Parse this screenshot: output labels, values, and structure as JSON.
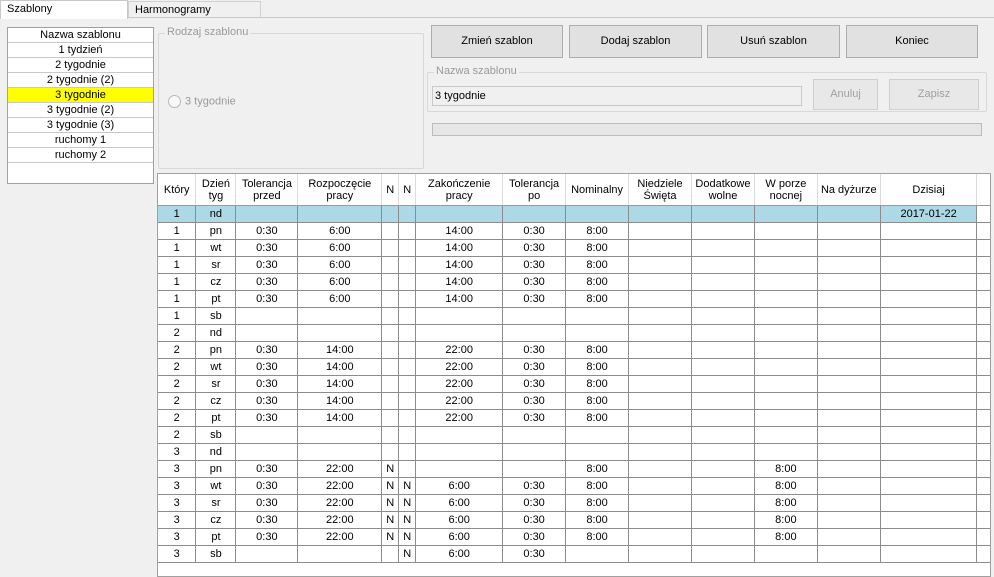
{
  "tabs": [
    "Szablony",
    "Harmonogramy"
  ],
  "templates": {
    "header": "Nazwa szablonu",
    "items": [
      "1 tydzień",
      "2 tygodnie",
      "2 tygodnie (2)",
      "3 tygodnie",
      "3 tygodnie (2)",
      "3 tygodnie (3)",
      "ruchomy 1",
      "ruchomy 2"
    ],
    "selected": "3 tygodnie"
  },
  "rodzaj": {
    "legend": "Rodzaj szablonu",
    "option": "3 tygodnie"
  },
  "buttons": {
    "zmien": "Zmień szablon",
    "dodaj": "Dodaj szablon",
    "usun": "Usuń szablon",
    "koniec": "Koniec",
    "anuluj": "Anuluj",
    "zapisz": "Zapisz"
  },
  "nazwa": {
    "legend": "Nazwa szablonu",
    "value": "3 tygodnie"
  },
  "grid": {
    "columns": [
      "Który",
      "Dzień tyg",
      "Tolerancja przed",
      "Rozpoczęcie pracy",
      "N",
      "N",
      "Zakończenie pracy",
      "Tolerancja po",
      "Nominalny",
      "Niedziele Święta",
      "Dodatkowe wolne",
      "W porze nocnej",
      "Na dyżurze",
      "Dzisiaj"
    ],
    "rows": [
      [
        "1",
        "nd",
        "",
        "",
        "",
        "",
        "",
        "",
        "",
        "",
        "",
        "",
        "",
        "2017-01-22"
      ],
      [
        "1",
        "pn",
        "0:30",
        "6:00",
        "",
        "",
        "14:00",
        "0:30",
        "8:00",
        "",
        "",
        "",
        "",
        ""
      ],
      [
        "1",
        "wt",
        "0:30",
        "6:00",
        "",
        "",
        "14:00",
        "0:30",
        "8:00",
        "",
        "",
        "",
        "",
        ""
      ],
      [
        "1",
        "sr",
        "0:30",
        "6:00",
        "",
        "",
        "14:00",
        "0:30",
        "8:00",
        "",
        "",
        "",
        "",
        ""
      ],
      [
        "1",
        "cz",
        "0:30",
        "6:00",
        "",
        "",
        "14:00",
        "0:30",
        "8:00",
        "",
        "",
        "",
        "",
        ""
      ],
      [
        "1",
        "pt",
        "0:30",
        "6:00",
        "",
        "",
        "14:00",
        "0:30",
        "8:00",
        "",
        "",
        "",
        "",
        ""
      ],
      [
        "1",
        "sb",
        "",
        "",
        "",
        "",
        "",
        "",
        "",
        "",
        "",
        "",
        "",
        ""
      ],
      [
        "2",
        "nd",
        "",
        "",
        "",
        "",
        "",
        "",
        "",
        "",
        "",
        "",
        "",
        ""
      ],
      [
        "2",
        "pn",
        "0:30",
        "14:00",
        "",
        "",
        "22:00",
        "0:30",
        "8:00",
        "",
        "",
        "",
        "",
        ""
      ],
      [
        "2",
        "wt",
        "0:30",
        "14:00",
        "",
        "",
        "22:00",
        "0:30",
        "8:00",
        "",
        "",
        "",
        "",
        ""
      ],
      [
        "2",
        "sr",
        "0:30",
        "14:00",
        "",
        "",
        "22:00",
        "0:30",
        "8:00",
        "",
        "",
        "",
        "",
        ""
      ],
      [
        "2",
        "cz",
        "0:30",
        "14:00",
        "",
        "",
        "22:00",
        "0:30",
        "8:00",
        "",
        "",
        "",
        "",
        ""
      ],
      [
        "2",
        "pt",
        "0:30",
        "14:00",
        "",
        "",
        "22:00",
        "0:30",
        "8:00",
        "",
        "",
        "",
        "",
        ""
      ],
      [
        "2",
        "sb",
        "",
        "",
        "",
        "",
        "",
        "",
        "",
        "",
        "",
        "",
        "",
        ""
      ],
      [
        "3",
        "nd",
        "",
        "",
        "",
        "",
        "",
        "",
        "",
        "",
        "",
        "",
        "",
        ""
      ],
      [
        "3",
        "pn",
        "0:30",
        "22:00",
        "N",
        "",
        "",
        "",
        "8:00",
        "",
        "",
        "8:00",
        "",
        ""
      ],
      [
        "3",
        "wt",
        "0:30",
        "22:00",
        "N",
        "N",
        "6:00",
        "0:30",
        "8:00",
        "",
        "",
        "8:00",
        "",
        ""
      ],
      [
        "3",
        "sr",
        "0:30",
        "22:00",
        "N",
        "N",
        "6:00",
        "0:30",
        "8:00",
        "",
        "",
        "8:00",
        "",
        ""
      ],
      [
        "3",
        "cz",
        "0:30",
        "22:00",
        "N",
        "N",
        "6:00",
        "0:30",
        "8:00",
        "",
        "",
        "8:00",
        "",
        ""
      ],
      [
        "3",
        "pt",
        "0:30",
        "22:00",
        "N",
        "N",
        "6:00",
        "0:30",
        "8:00",
        "",
        "",
        "8:00",
        "",
        ""
      ],
      [
        "3",
        "sb",
        "",
        "",
        "",
        "N",
        "6:00",
        "0:30",
        "",
        "",
        "",
        "",
        "",
        ""
      ]
    ],
    "highlight_row": 0,
    "highlight_color": "#add8e6",
    "selected_item_color": "#ffff00"
  }
}
